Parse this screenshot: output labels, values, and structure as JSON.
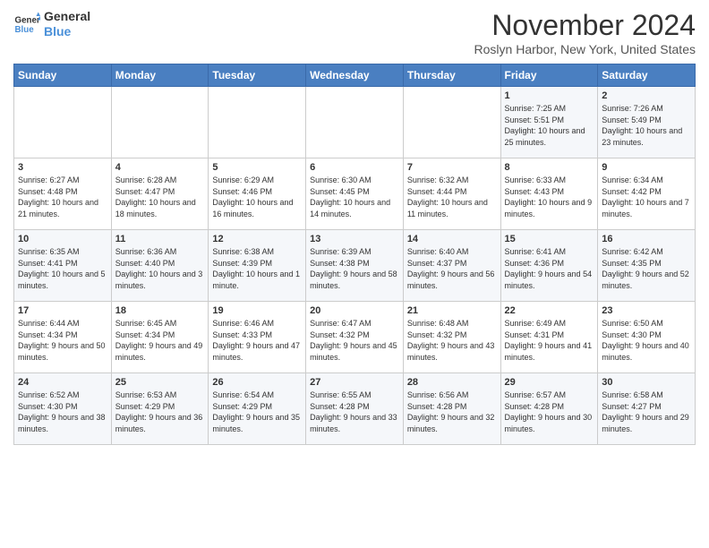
{
  "logo": {
    "line1": "General",
    "line2": "Blue"
  },
  "title": "November 2024",
  "location": "Roslyn Harbor, New York, United States",
  "days_of_week": [
    "Sunday",
    "Monday",
    "Tuesday",
    "Wednesday",
    "Thursday",
    "Friday",
    "Saturday"
  ],
  "weeks": [
    [
      {
        "day": "",
        "sunrise": "",
        "sunset": "",
        "daylight": ""
      },
      {
        "day": "",
        "sunrise": "",
        "sunset": "",
        "daylight": ""
      },
      {
        "day": "",
        "sunrise": "",
        "sunset": "",
        "daylight": ""
      },
      {
        "day": "",
        "sunrise": "",
        "sunset": "",
        "daylight": ""
      },
      {
        "day": "",
        "sunrise": "",
        "sunset": "",
        "daylight": ""
      },
      {
        "day": "1",
        "sunrise": "Sunrise: 7:25 AM",
        "sunset": "Sunset: 5:51 PM",
        "daylight": "Daylight: 10 hours and 25 minutes."
      },
      {
        "day": "2",
        "sunrise": "Sunrise: 7:26 AM",
        "sunset": "Sunset: 5:49 PM",
        "daylight": "Daylight: 10 hours and 23 minutes."
      }
    ],
    [
      {
        "day": "3",
        "sunrise": "Sunrise: 6:27 AM",
        "sunset": "Sunset: 4:48 PM",
        "daylight": "Daylight: 10 hours and 21 minutes."
      },
      {
        "day": "4",
        "sunrise": "Sunrise: 6:28 AM",
        "sunset": "Sunset: 4:47 PM",
        "daylight": "Daylight: 10 hours and 18 minutes."
      },
      {
        "day": "5",
        "sunrise": "Sunrise: 6:29 AM",
        "sunset": "Sunset: 4:46 PM",
        "daylight": "Daylight: 10 hours and 16 minutes."
      },
      {
        "day": "6",
        "sunrise": "Sunrise: 6:30 AM",
        "sunset": "Sunset: 4:45 PM",
        "daylight": "Daylight: 10 hours and 14 minutes."
      },
      {
        "day": "7",
        "sunrise": "Sunrise: 6:32 AM",
        "sunset": "Sunset: 4:44 PM",
        "daylight": "Daylight: 10 hours and 11 minutes."
      },
      {
        "day": "8",
        "sunrise": "Sunrise: 6:33 AM",
        "sunset": "Sunset: 4:43 PM",
        "daylight": "Daylight: 10 hours and 9 minutes."
      },
      {
        "day": "9",
        "sunrise": "Sunrise: 6:34 AM",
        "sunset": "Sunset: 4:42 PM",
        "daylight": "Daylight: 10 hours and 7 minutes."
      }
    ],
    [
      {
        "day": "10",
        "sunrise": "Sunrise: 6:35 AM",
        "sunset": "Sunset: 4:41 PM",
        "daylight": "Daylight: 10 hours and 5 minutes."
      },
      {
        "day": "11",
        "sunrise": "Sunrise: 6:36 AM",
        "sunset": "Sunset: 4:40 PM",
        "daylight": "Daylight: 10 hours and 3 minutes."
      },
      {
        "day": "12",
        "sunrise": "Sunrise: 6:38 AM",
        "sunset": "Sunset: 4:39 PM",
        "daylight": "Daylight: 10 hours and 1 minute."
      },
      {
        "day": "13",
        "sunrise": "Sunrise: 6:39 AM",
        "sunset": "Sunset: 4:38 PM",
        "daylight": "Daylight: 9 hours and 58 minutes."
      },
      {
        "day": "14",
        "sunrise": "Sunrise: 6:40 AM",
        "sunset": "Sunset: 4:37 PM",
        "daylight": "Daylight: 9 hours and 56 minutes."
      },
      {
        "day": "15",
        "sunrise": "Sunrise: 6:41 AM",
        "sunset": "Sunset: 4:36 PM",
        "daylight": "Daylight: 9 hours and 54 minutes."
      },
      {
        "day": "16",
        "sunrise": "Sunrise: 6:42 AM",
        "sunset": "Sunset: 4:35 PM",
        "daylight": "Daylight: 9 hours and 52 minutes."
      }
    ],
    [
      {
        "day": "17",
        "sunrise": "Sunrise: 6:44 AM",
        "sunset": "Sunset: 4:34 PM",
        "daylight": "Daylight: 9 hours and 50 minutes."
      },
      {
        "day": "18",
        "sunrise": "Sunrise: 6:45 AM",
        "sunset": "Sunset: 4:34 PM",
        "daylight": "Daylight: 9 hours and 49 minutes."
      },
      {
        "day": "19",
        "sunrise": "Sunrise: 6:46 AM",
        "sunset": "Sunset: 4:33 PM",
        "daylight": "Daylight: 9 hours and 47 minutes."
      },
      {
        "day": "20",
        "sunrise": "Sunrise: 6:47 AM",
        "sunset": "Sunset: 4:32 PM",
        "daylight": "Daylight: 9 hours and 45 minutes."
      },
      {
        "day": "21",
        "sunrise": "Sunrise: 6:48 AM",
        "sunset": "Sunset: 4:32 PM",
        "daylight": "Daylight: 9 hours and 43 minutes."
      },
      {
        "day": "22",
        "sunrise": "Sunrise: 6:49 AM",
        "sunset": "Sunset: 4:31 PM",
        "daylight": "Daylight: 9 hours and 41 minutes."
      },
      {
        "day": "23",
        "sunrise": "Sunrise: 6:50 AM",
        "sunset": "Sunset: 4:30 PM",
        "daylight": "Daylight: 9 hours and 40 minutes."
      }
    ],
    [
      {
        "day": "24",
        "sunrise": "Sunrise: 6:52 AM",
        "sunset": "Sunset: 4:30 PM",
        "daylight": "Daylight: 9 hours and 38 minutes."
      },
      {
        "day": "25",
        "sunrise": "Sunrise: 6:53 AM",
        "sunset": "Sunset: 4:29 PM",
        "daylight": "Daylight: 9 hours and 36 minutes."
      },
      {
        "day": "26",
        "sunrise": "Sunrise: 6:54 AM",
        "sunset": "Sunset: 4:29 PM",
        "daylight": "Daylight: 9 hours and 35 minutes."
      },
      {
        "day": "27",
        "sunrise": "Sunrise: 6:55 AM",
        "sunset": "Sunset: 4:28 PM",
        "daylight": "Daylight: 9 hours and 33 minutes."
      },
      {
        "day": "28",
        "sunrise": "Sunrise: 6:56 AM",
        "sunset": "Sunset: 4:28 PM",
        "daylight": "Daylight: 9 hours and 32 minutes."
      },
      {
        "day": "29",
        "sunrise": "Sunrise: 6:57 AM",
        "sunset": "Sunset: 4:28 PM",
        "daylight": "Daylight: 9 hours and 30 minutes."
      },
      {
        "day": "30",
        "sunrise": "Sunrise: 6:58 AM",
        "sunset": "Sunset: 4:27 PM",
        "daylight": "Daylight: 9 hours and 29 minutes."
      }
    ]
  ]
}
